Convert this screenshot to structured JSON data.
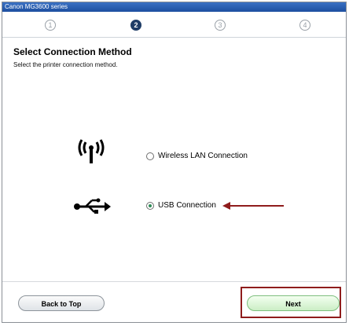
{
  "window": {
    "title": "Canon MG3600 series"
  },
  "steps": [
    {
      "label": "1",
      "active": false
    },
    {
      "label": "2",
      "active": true
    },
    {
      "label": "3",
      "active": false
    },
    {
      "label": "4",
      "active": false
    }
  ],
  "header": {
    "title": "Select Connection Method",
    "subtitle": "Select the printer connection method."
  },
  "options": [
    {
      "label": "Wireless LAN Connection",
      "selected": false,
      "icon": "wireless-icon"
    },
    {
      "label": "USB Connection",
      "selected": true,
      "icon": "usb-icon"
    }
  ],
  "footer": {
    "back_label": "Back to Top",
    "next_label": "Next"
  },
  "colors": {
    "accent_arrow": "#8f1c1c",
    "selected_radio": "#2e8b57",
    "active_step": "#1f3c66"
  }
}
